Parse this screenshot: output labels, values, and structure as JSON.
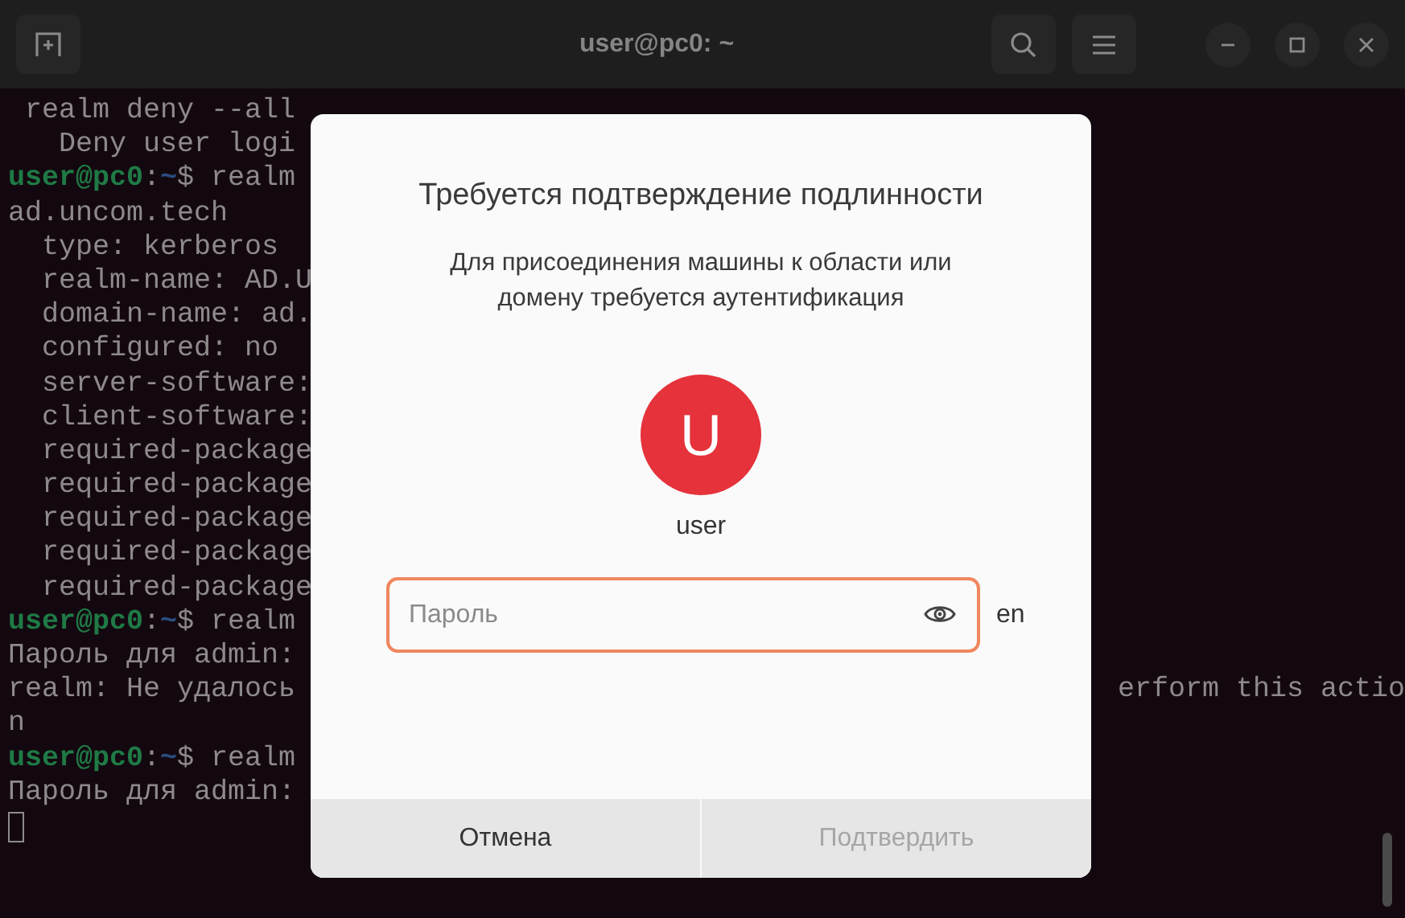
{
  "window": {
    "title": "user@pc0: ~"
  },
  "terminal": {
    "lines": [
      {
        "kind": "output",
        "text": " realm deny --all"
      },
      {
        "kind": "output",
        "text": "   Deny user logi"
      },
      {
        "kind": "prompt",
        "user": "user@pc0",
        "colon": ":",
        "path": "~",
        "command": "$ realm"
      },
      {
        "kind": "output",
        "text": "ad.uncom.tech"
      },
      {
        "kind": "output",
        "text": "  type: kerberos"
      },
      {
        "kind": "output",
        "text": "  realm-name: AD.U"
      },
      {
        "kind": "output",
        "text": "  domain-name: ad."
      },
      {
        "kind": "output",
        "text": "  configured: no"
      },
      {
        "kind": "output",
        "text": "  server-software:"
      },
      {
        "kind": "output",
        "text": "  client-software:"
      },
      {
        "kind": "output",
        "text": "  required-package"
      },
      {
        "kind": "output",
        "text": "  required-package"
      },
      {
        "kind": "output",
        "text": "  required-package"
      },
      {
        "kind": "output",
        "text": "  required-package"
      },
      {
        "kind": "output",
        "text": "  required-package"
      },
      {
        "kind": "prompt",
        "user": "user@pc0",
        "colon": ":",
        "path": "~",
        "command": "$ realm"
      },
      {
        "kind": "output",
        "text": "Пароль для admin:"
      },
      {
        "kind": "output",
        "text": "realm: Не удалось",
        "text_right": "erform this actio"
      },
      {
        "kind": "output",
        "text": "n"
      },
      {
        "kind": "prompt",
        "user": "user@pc0",
        "colon": ":",
        "path": "~",
        "command": "$ realm"
      },
      {
        "kind": "output",
        "text": "Пароль для admin:"
      },
      {
        "kind": "cursor"
      }
    ]
  },
  "dialog": {
    "title": "Требуется подтверждение подлинности",
    "message": "Для присоединения машины к области или домену требуется аутентификация",
    "avatar": {
      "initial": "U"
    },
    "username": "user",
    "password": {
      "placeholder": "Пароль"
    },
    "input_layout": "en",
    "buttons": [
      {
        "label": "Отмена",
        "disabled": false
      },
      {
        "label": "Подтвердить",
        "disabled": true
      }
    ]
  }
}
